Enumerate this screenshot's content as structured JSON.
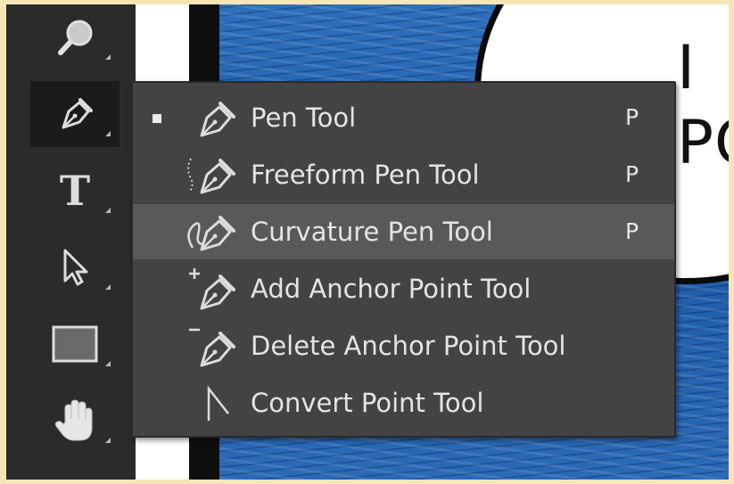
{
  "canvas": {
    "bubble_text": [
      "I",
      "PO"
    ]
  },
  "toolbar": {
    "tools": [
      {
        "icon": "zoom-icon",
        "active": false
      },
      {
        "icon": "pen-icon",
        "active": true
      },
      {
        "icon": "type-icon",
        "active": false
      },
      {
        "icon": "path-selection-icon",
        "active": false
      },
      {
        "icon": "rectangle-icon",
        "active": false
      },
      {
        "icon": "hand-icon",
        "active": false
      }
    ],
    "type_glyph": "T"
  },
  "flyout": {
    "items": [
      {
        "label": "Pen Tool",
        "shortcut": "P",
        "icon": "pen-tool-icon",
        "selected": true
      },
      {
        "label": "Freeform Pen Tool",
        "shortcut": "P",
        "icon": "freeform-pen-icon",
        "selected": false
      },
      {
        "label": "Curvature Pen Tool",
        "shortcut": "P",
        "icon": "curvature-pen-icon",
        "selected": false,
        "hover": true
      },
      {
        "label": "Add Anchor Point Tool",
        "shortcut": "",
        "icon": "add-anchor-point-icon",
        "selected": false
      },
      {
        "label": "Delete Anchor Point Tool",
        "shortcut": "",
        "icon": "delete-anchor-point-icon",
        "selected": false
      },
      {
        "label": "Convert Point Tool",
        "shortcut": "",
        "icon": "convert-point-icon",
        "selected": false
      }
    ]
  },
  "colors": {
    "menu_bg": "#434343",
    "menu_hover": "#595959",
    "toolbar_bg": "#2b2b2b",
    "water": "#1c5ba9",
    "outer_border": "#f6e6b4"
  }
}
